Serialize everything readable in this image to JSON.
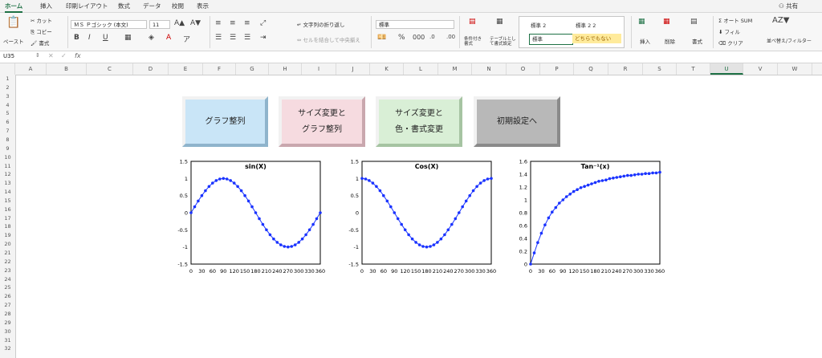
{
  "tabs": [
    "ホーム",
    "挿入",
    "印刷レイアウト",
    "数式",
    "データ",
    "校閲",
    "表示"
  ],
  "share_label": "共有",
  "ribbon": {
    "paste": "ペースト",
    "cut": "カット",
    "copy": "コピー",
    "format_painter": "書式",
    "font_name": "ＭＳ Ｐゴシック (本文)",
    "font_size": "11",
    "wrap_text": "文字列の折り返し",
    "merge_center": "セルを結合して中央揃え",
    "number_format": "標準",
    "cond_format": "条件付き書式",
    "table_format": "テーブルとして書式設定",
    "style1": "標準 2",
    "style2": "標準 2 2",
    "style3": "標準",
    "style4": "どちらでもない",
    "insert": "挿入",
    "delete": "削除",
    "format": "書式",
    "autosum": "オート SUM",
    "fill": "フィル",
    "clear": "クリア",
    "sort_filter": "並べ替え/フィルター"
  },
  "name_box": "U35",
  "fx": "fx",
  "columns": [
    "A",
    "B",
    "C",
    "D",
    "E",
    "F",
    "G",
    "H",
    "I",
    "J",
    "K",
    "L",
    "M",
    "N",
    "O",
    "P",
    "Q",
    "R",
    "S",
    "T",
    "U",
    "V",
    "W"
  ],
  "selected_column": "U",
  "rows": [
    "1",
    "2",
    "3",
    "4",
    "5",
    "6",
    "7",
    "8",
    "9",
    "10",
    "11",
    "12",
    "13",
    "14",
    "15",
    "16",
    "17",
    "18",
    "19",
    "20",
    "21",
    "22",
    "23",
    "24",
    "25",
    "26",
    "27",
    "28",
    "29",
    "30",
    "31",
    "32"
  ],
  "buttons": [
    {
      "line1": "グラフ整列",
      "line2": "",
      "face": "#c9e5f7",
      "border": "#8fb4cc"
    },
    {
      "line1": "サイズ変更と",
      "line2": "グラフ整列",
      "face": "#f6dbe0",
      "border": "#c9a7ae"
    },
    {
      "line1": "サイズ変更と",
      "line2": "色・書式変更",
      "face": "#d9efd6",
      "border": "#a6c4a2"
    },
    {
      "line1": "初期設定へ",
      "line2": "",
      "face": "#b8b8b8",
      "border": "#8a8a8a"
    }
  ],
  "chart_data": [
    {
      "type": "line",
      "title": "sin(X)",
      "marker_color": "#1a33ff",
      "ylim": [
        -1.5,
        1.5
      ],
      "yticks": [
        "1.5",
        "1",
        "0.5",
        "0",
        "-0.5",
        "-1",
        "-1.5"
      ],
      "xticks": [
        "0",
        "30",
        "60",
        "90",
        "120",
        "150",
        "180",
        "210",
        "240",
        "270",
        "300",
        "330",
        "360"
      ],
      "x": [
        0,
        10,
        20,
        30,
        40,
        50,
        60,
        70,
        80,
        90,
        100,
        110,
        120,
        130,
        140,
        150,
        160,
        170,
        180,
        190,
        200,
        210,
        220,
        230,
        240,
        250,
        260,
        270,
        280,
        290,
        300,
        310,
        320,
        330,
        340,
        350,
        360
      ],
      "y": [
        0,
        0.174,
        0.342,
        0.5,
        0.643,
        0.766,
        0.866,
        0.94,
        0.985,
        1,
        0.985,
        0.94,
        0.866,
        0.766,
        0.643,
        0.5,
        0.342,
        0.174,
        0,
        -0.174,
        -0.342,
        -0.5,
        -0.643,
        -0.766,
        -0.866,
        -0.94,
        -0.985,
        -1,
        -0.985,
        -0.94,
        -0.866,
        -0.766,
        -0.643,
        -0.5,
        -0.342,
        -0.174,
        0
      ]
    },
    {
      "type": "line",
      "title": "Cos(X)",
      "marker_color": "#1a33ff",
      "ylim": [
        -1.5,
        1.5
      ],
      "yticks": [
        "1.5",
        "1",
        "0.5",
        "0",
        "-0.5",
        "-1",
        "-1.5"
      ],
      "xticks": [
        "0",
        "30",
        "60",
        "90",
        "120",
        "150",
        "180",
        "210",
        "240",
        "270",
        "300",
        "330",
        "360"
      ],
      "x": [
        0,
        10,
        20,
        30,
        40,
        50,
        60,
        70,
        80,
        90,
        100,
        110,
        120,
        130,
        140,
        150,
        160,
        170,
        180,
        190,
        200,
        210,
        220,
        230,
        240,
        250,
        260,
        270,
        280,
        290,
        300,
        310,
        320,
        330,
        340,
        350,
        360
      ],
      "y": [
        1,
        0.985,
        0.94,
        0.866,
        0.766,
        0.643,
        0.5,
        0.342,
        0.174,
        0,
        -0.174,
        -0.342,
        -0.5,
        -0.643,
        -0.766,
        -0.866,
        -0.94,
        -0.985,
        -1,
        -0.985,
        -0.94,
        -0.866,
        -0.766,
        -0.643,
        -0.5,
        -0.342,
        -0.174,
        0,
        0.174,
        0.342,
        0.5,
        0.643,
        0.766,
        0.866,
        0.94,
        0.985,
        1
      ]
    },
    {
      "type": "line",
      "title": "Tan⁻¹(x)",
      "marker_color": "#1a33ff",
      "ylim": [
        0,
        1.6
      ],
      "yticks": [
        "1.6",
        "1.4",
        "1.2",
        "1",
        "0.8",
        "0.6",
        "0.4",
        "0.2",
        "0"
      ],
      "xticks": [
        "0",
        "30",
        "60",
        "90",
        "120",
        "150",
        "180",
        "210",
        "240",
        "270",
        "300",
        "330",
        "360"
      ],
      "x": [
        0,
        10,
        20,
        30,
        40,
        50,
        60,
        70,
        80,
        90,
        100,
        110,
        120,
        130,
        140,
        150,
        160,
        170,
        180,
        190,
        200,
        210,
        220,
        230,
        240,
        250,
        260,
        270,
        280,
        290,
        300,
        310,
        320,
        330,
        340,
        350,
        360
      ],
      "y": [
        0,
        0.174,
        0.335,
        0.48,
        0.61,
        0.72,
        0.81,
        0.88,
        0.95,
        1.0,
        1.05,
        1.09,
        1.13,
        1.16,
        1.19,
        1.21,
        1.23,
        1.25,
        1.27,
        1.29,
        1.3,
        1.31,
        1.33,
        1.34,
        1.35,
        1.36,
        1.37,
        1.38,
        1.38,
        1.39,
        1.4,
        1.4,
        1.41,
        1.41,
        1.42,
        1.42,
        1.43
      ]
    }
  ]
}
